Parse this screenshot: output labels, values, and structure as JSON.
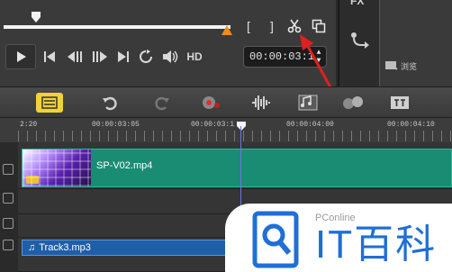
{
  "player": {
    "buttons": [
      "play",
      "go-to-start",
      "previous-frame",
      "next-frame",
      "go-to-end",
      "repeat",
      "volume"
    ],
    "hd_label": "HD",
    "trim": {
      "mark_in": "[",
      "mark_out": "]"
    },
    "timecode": "00:00:03:1"
  },
  "library": {
    "tab_label": "FX",
    "browse_label": "浏览"
  },
  "toolbar": [
    "storyboard-view",
    "undo",
    "redo",
    "record-capture",
    "sound-mixer",
    "auto-music",
    "motion-tracking",
    "subtitle-editor"
  ],
  "ruler": {
    "labels": [
      "2:20",
      "00:00:03:05",
      "00:00:03:1",
      "00:00:04:00",
      "00:00:04:10"
    ]
  },
  "tracks": {
    "video_clip": "SP-V02.mp4",
    "audio_clip": "Track3.mp3"
  },
  "watermark": {
    "site": "PConline",
    "brand": "IT百科"
  },
  "colors": {
    "clip_green": "#1a8c74",
    "audio_blue": "#1f5fa8",
    "annotation_red": "#e0201e",
    "accent_yellow": "#f1d238",
    "playhead_blue": "#6a78d8",
    "brand_blue": "#1f6fd6"
  }
}
